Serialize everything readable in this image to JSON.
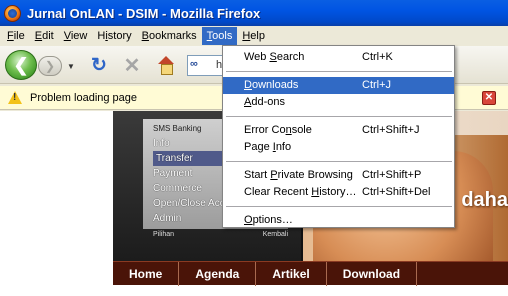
{
  "window": {
    "title": "Jurnal OnLAN - DSIM - Mozilla Firefox"
  },
  "menubar": {
    "items": [
      {
        "key": "F",
        "rest": "ile"
      },
      {
        "key": "E",
        "rest": "dit"
      },
      {
        "key": "V",
        "rest": "iew"
      },
      {
        "key": "H",
        "rest": "istory",
        "prefix": ""
      },
      {
        "key": "B",
        "rest": "ookmarks"
      },
      {
        "key": "T",
        "rest": "ools"
      },
      {
        "key": "H",
        "rest": "elp"
      }
    ]
  },
  "navbar": {
    "url_fragment": "h"
  },
  "notification": {
    "message": "Problem loading page"
  },
  "tools_menu": {
    "items": [
      {
        "pre": "Web ",
        "key": "S",
        "post": "earch",
        "shortcut": "Ctrl+K"
      },
      {
        "pre": "",
        "key": "D",
        "post": "ownloads",
        "shortcut": "Ctrl+J",
        "highlighted": true
      },
      {
        "pre": "",
        "key": "A",
        "post": "dd-ons",
        "shortcut": ""
      },
      {
        "pre": "Error Co",
        "key": "n",
        "post": "sole",
        "shortcut": "Ctrl+Shift+J"
      },
      {
        "pre": "Page ",
        "key": "I",
        "post": "nfo",
        "shortcut": ""
      },
      {
        "pre": "Start ",
        "key": "P",
        "post": "rivate Browsing",
        "shortcut": "Ctrl+Shift+P"
      },
      {
        "pre": "Clear Recent ",
        "key": "H",
        "post": "istory…",
        "shortcut": "Ctrl+Shift+Del"
      },
      {
        "pre": "",
        "key": "O",
        "post": "ptions…",
        "shortcut": ""
      }
    ]
  },
  "page": {
    "phone_menu": {
      "header": "SMS Banking",
      "rows": [
        "Info",
        "Transfer",
        "Payment",
        "Commerce",
        "Open/Close Acc",
        "Admin"
      ],
      "softkeys": [
        "Pilihan",
        "Kembali"
      ]
    },
    "hero_text": "daha",
    "site_nav": [
      "Home",
      "Agenda",
      "Artikel",
      "Download"
    ]
  }
}
